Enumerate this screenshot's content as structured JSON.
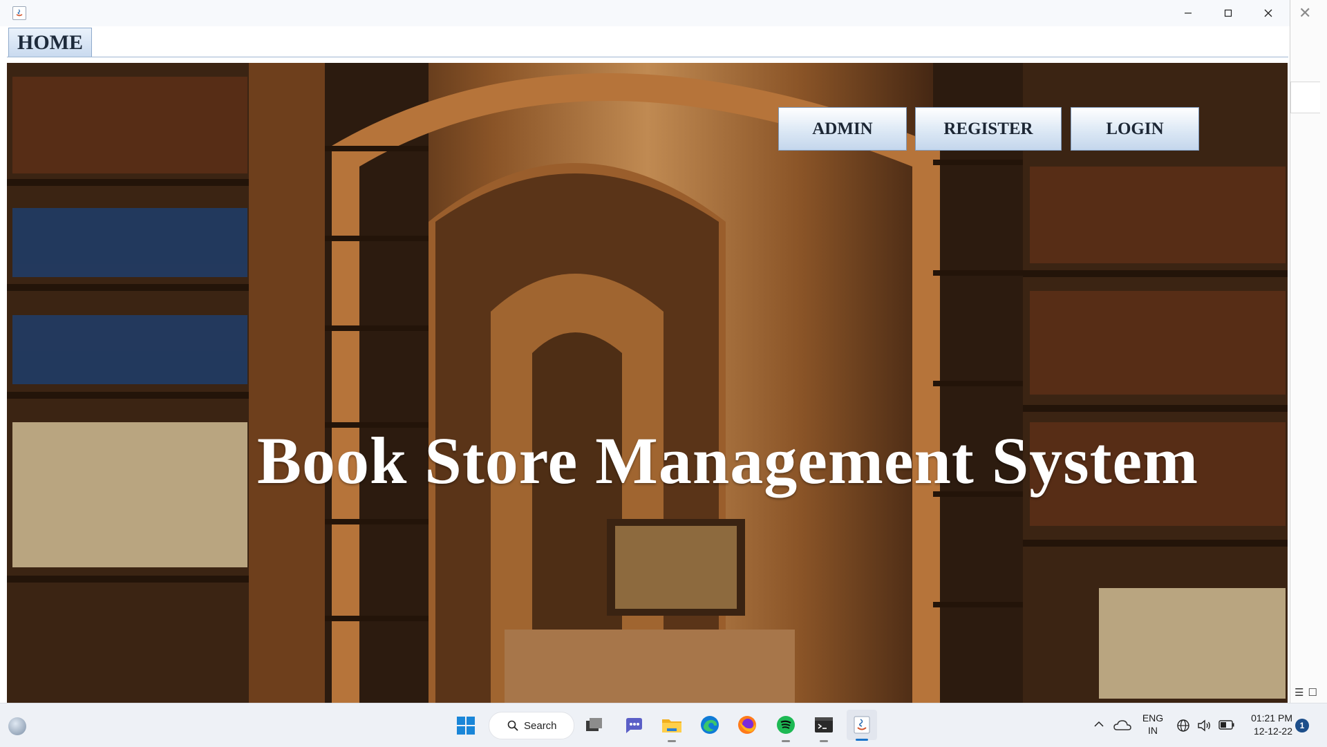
{
  "window": {
    "app_icon": "java-icon",
    "controls": [
      "minimize-icon",
      "maximize-icon",
      "close-icon"
    ]
  },
  "tabs": [
    {
      "label": "HOME",
      "selected": true
    }
  ],
  "buttons": {
    "admin": "ADMIN",
    "register": "REGISTER",
    "login": "LOGIN"
  },
  "title": "Book Store Management System",
  "taskbar": {
    "search_label": "Search",
    "apps": [
      "task-view-icon",
      "meet-icon",
      "file-explorer-icon",
      "edge-icon",
      "firefox-icon",
      "spotify-icon",
      "terminal-icon",
      "java-icon"
    ],
    "language_line1": "ENG",
    "language_line2": "IN",
    "time": "01:21 PM",
    "date": "12-12-22",
    "notification_count": "1"
  },
  "colors": {
    "button_gradient_top": "#ffffff",
    "button_gradient_bottom": "#c4d6ec",
    "title_text": "#ffffff",
    "wood": "#8a5427"
  }
}
